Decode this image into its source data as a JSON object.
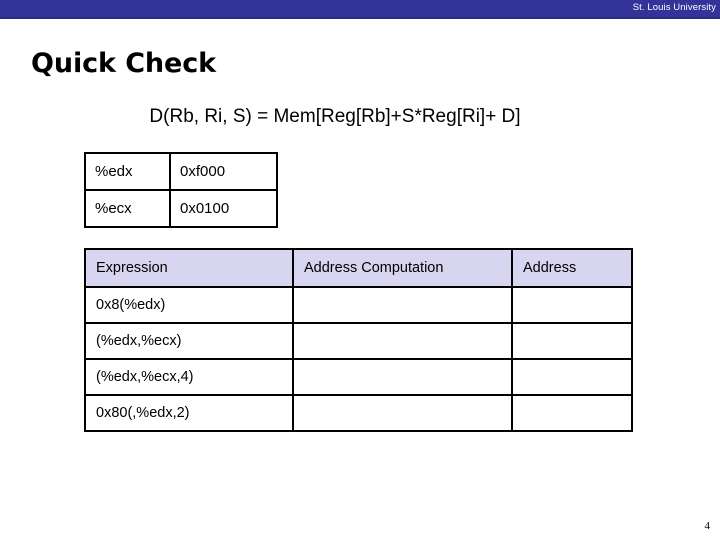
{
  "banner": {
    "institution": "St. Louis University",
    "background_color": "#333399",
    "text_color": "#ffffff"
  },
  "slide": {
    "title": "Quick Check",
    "formula": "D(Rb, Ri, S) = Mem[Reg[Rb]+S*Reg[Ri]+ D]",
    "page_number": "4"
  },
  "register_table": {
    "rows": [
      {
        "name": "%edx",
        "value": "0xf000"
      },
      {
        "name": "%ecx",
        "value": "0x0100"
      }
    ]
  },
  "expression_table": {
    "header_background": "#d8d5f0",
    "headers": {
      "expression": "Expression",
      "address_computation": "Address Computation",
      "address": "Address"
    },
    "rows": [
      {
        "expression": "0x8(%edx)",
        "address_computation": "",
        "address": ""
      },
      {
        "expression": "(%edx,%ecx)",
        "address_computation": "",
        "address": ""
      },
      {
        "expression": "(%edx,%ecx,4)",
        "address_computation": "",
        "address": ""
      },
      {
        "expression": "0x80(,%edx,2)",
        "address_computation": "",
        "address": ""
      }
    ]
  }
}
